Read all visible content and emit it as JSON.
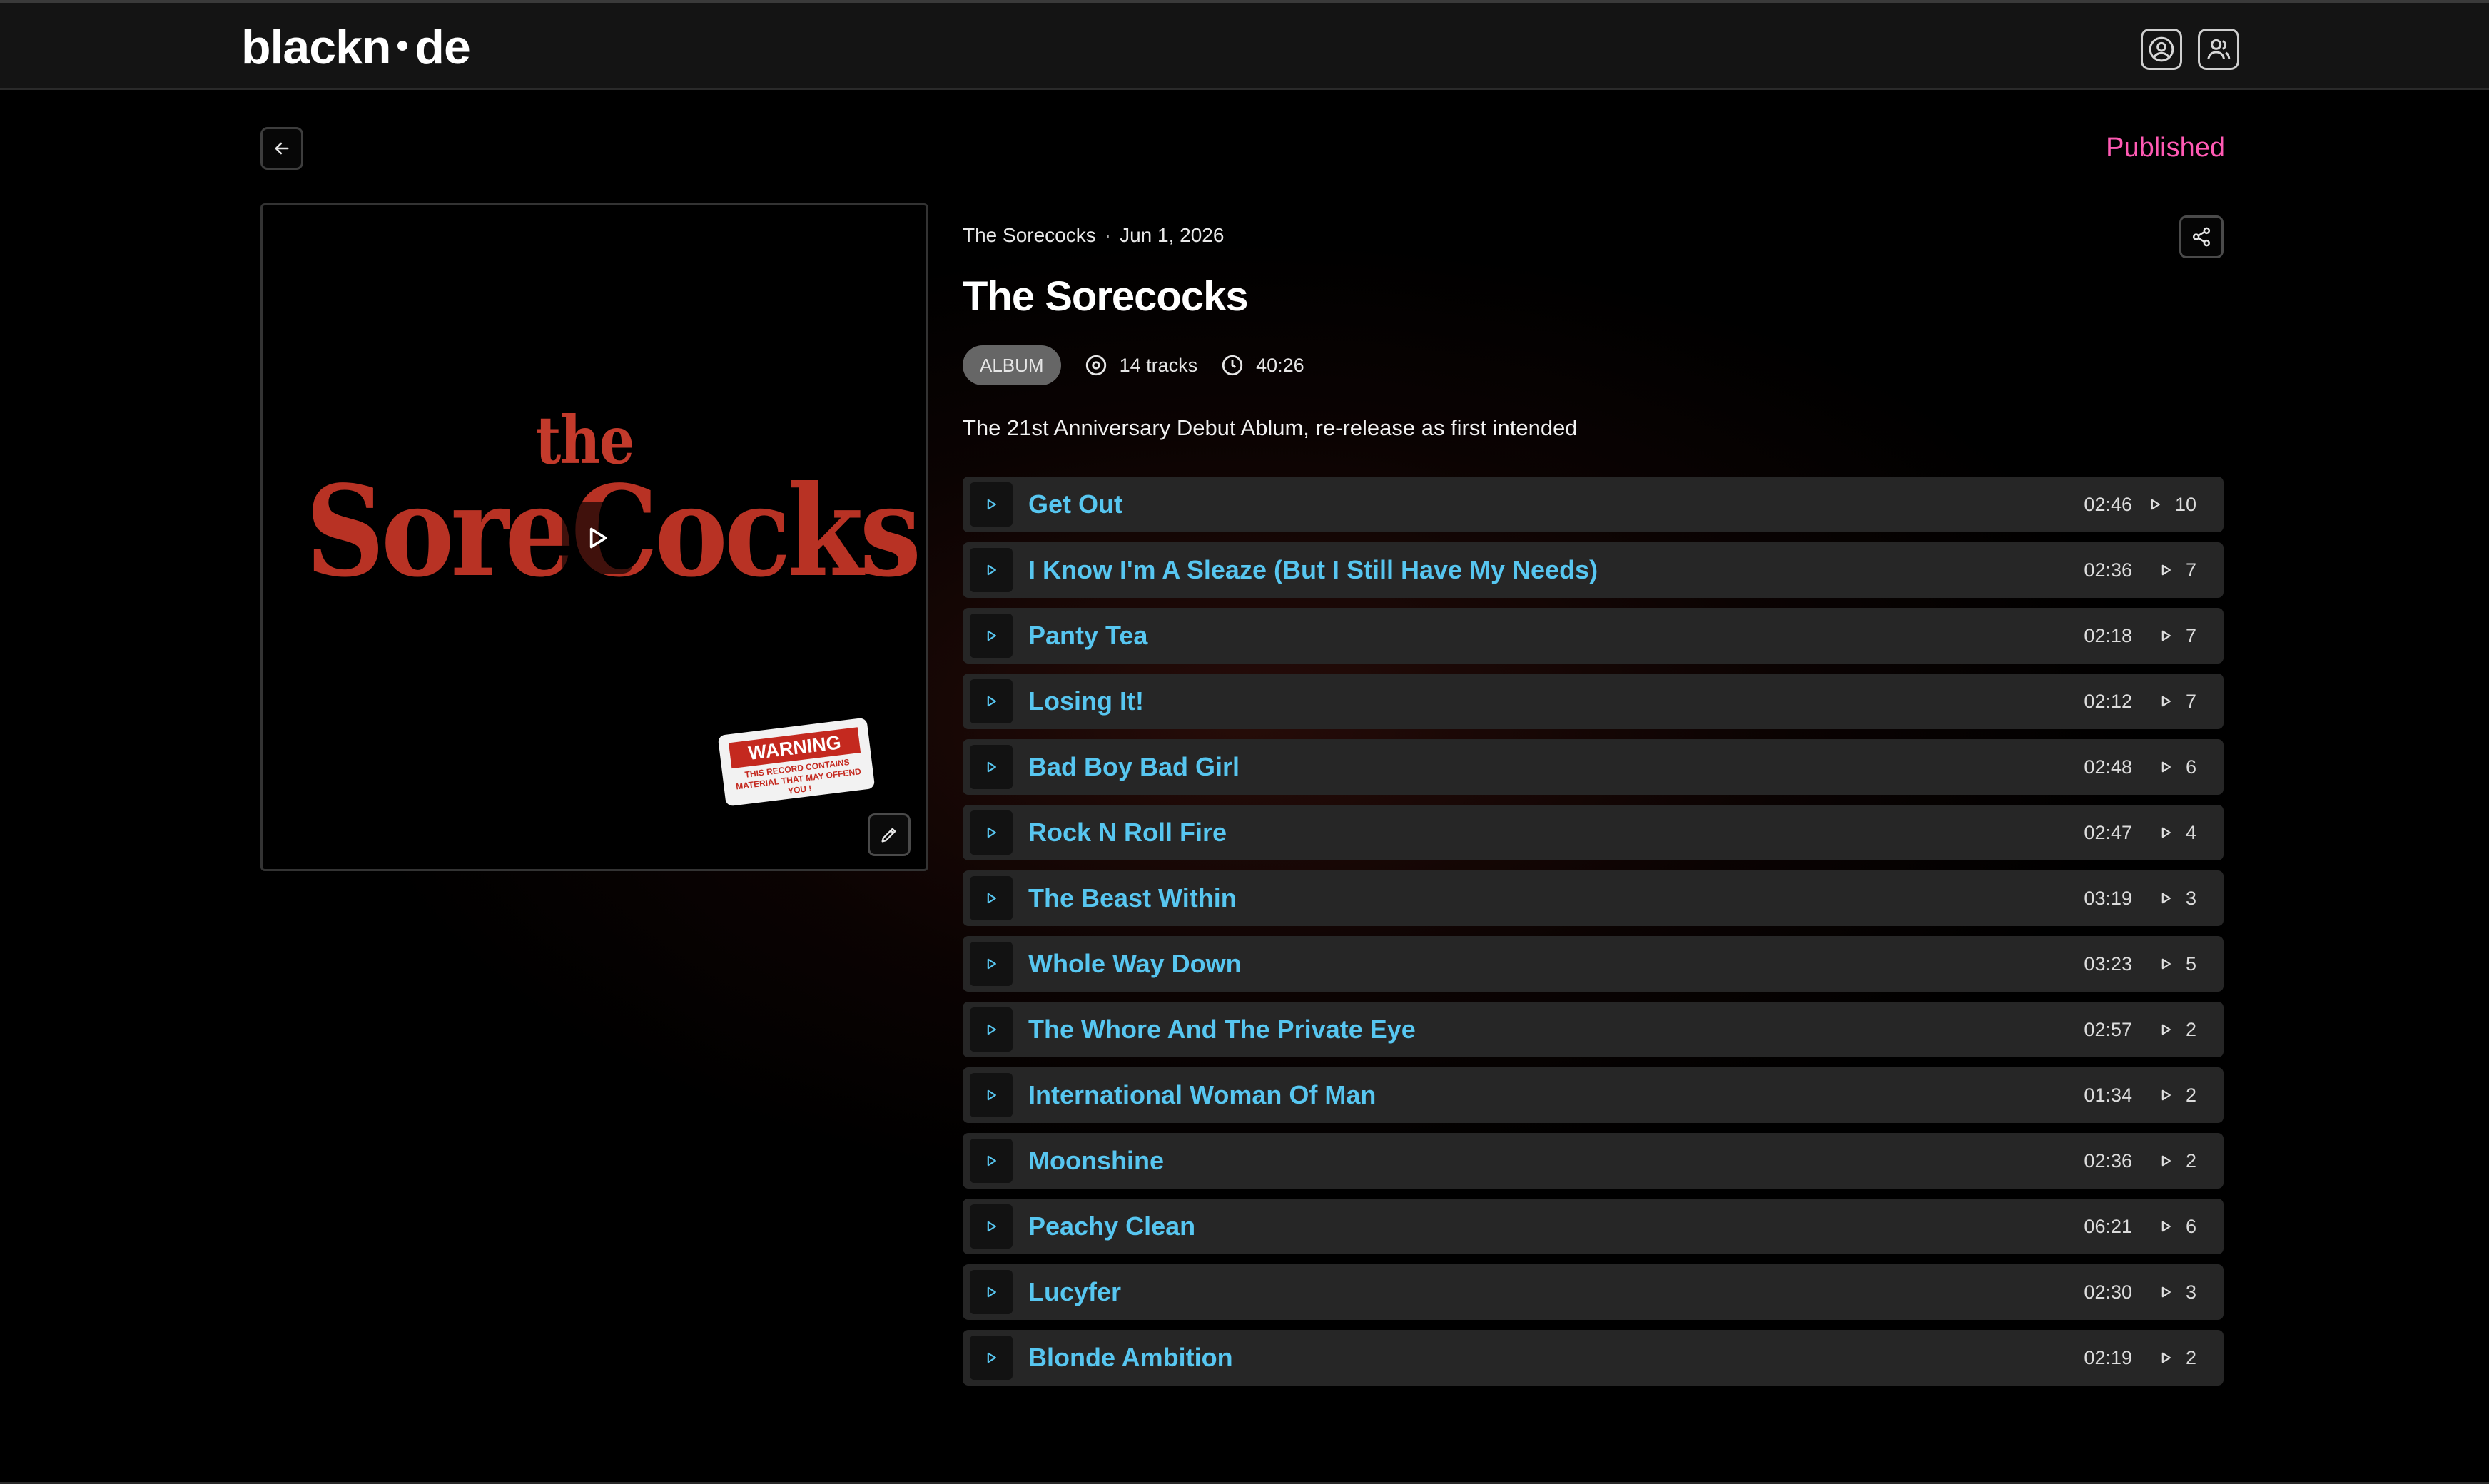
{
  "header": {
    "logo_left": "blackn",
    "logo_right": "de",
    "profile_icon": "user-circle-icon",
    "switch_account_icon": "users-icon"
  },
  "page": {
    "back_icon": "arrow-left-icon",
    "status": "Published",
    "status_color": "#ff5ab4"
  },
  "cover": {
    "art_text_the": "the",
    "art_text_band": "SoreCocks",
    "warning_title": "WARNING",
    "warning_text": "THIS RECORD CONTAINS MATERIAL THAT MAY OFFEND YOU !",
    "play_icon": "play-icon",
    "edit_icon": "pencil-icon"
  },
  "release": {
    "artist": "The Sorecocks",
    "date": "Jun 1, 2026",
    "title": "The Sorecocks",
    "type": "ALBUM",
    "track_count": "14 tracks",
    "duration": "40:26",
    "description": "The 21st Anniversary Debut Ablum, re-release as first intended",
    "share_icon": "share-icon"
  },
  "accent_colors": {
    "track_title": "#57c6f0",
    "play_icon": "#57c6f0"
  },
  "tracks": [
    {
      "name": "Get Out",
      "duration": "02:46",
      "plays": "10"
    },
    {
      "name": "I Know I'm A Sleaze (But I Still Have My Needs)",
      "duration": "02:36",
      "plays": "7"
    },
    {
      "name": "Panty Tea",
      "duration": "02:18",
      "plays": "7"
    },
    {
      "name": "Losing It!",
      "duration": "02:12",
      "plays": "7"
    },
    {
      "name": "Bad Boy Bad Girl",
      "duration": "02:48",
      "plays": "6"
    },
    {
      "name": "Rock N Roll Fire",
      "duration": "02:47",
      "plays": "4"
    },
    {
      "name": "The Beast Within",
      "duration": "03:19",
      "plays": "3"
    },
    {
      "name": "Whole Way Down",
      "duration": "03:23",
      "plays": "5"
    },
    {
      "name": "The Whore And The Private Eye",
      "duration": "02:57",
      "plays": "2"
    },
    {
      "name": "International Woman Of Man",
      "duration": "01:34",
      "plays": "2"
    },
    {
      "name": "Moonshine",
      "duration": "02:36",
      "plays": "2"
    },
    {
      "name": "Peachy Clean",
      "duration": "06:21",
      "plays": "6"
    },
    {
      "name": "Lucyfer",
      "duration": "02:30",
      "plays": "3"
    },
    {
      "name": "Blonde Ambition",
      "duration": "02:19",
      "plays": "2"
    }
  ]
}
